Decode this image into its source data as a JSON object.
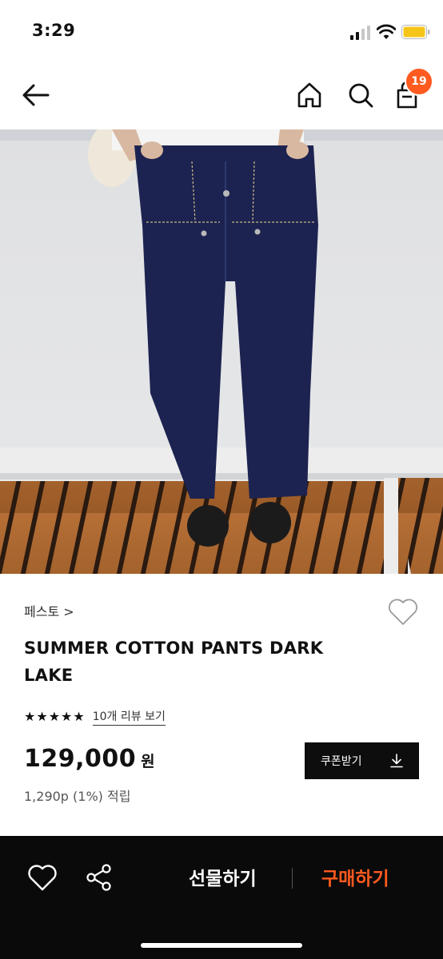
{
  "status_bar": {
    "time": "3:29"
  },
  "nav": {
    "cart_count": "19"
  },
  "product": {
    "brand": "페스토 >",
    "title": "SUMMER COTTON PANTS DARK LAKE",
    "stars": [
      "★",
      "★",
      "★",
      "★",
      "★"
    ],
    "review_link": "10개 리뷰 보기",
    "price": "129,000",
    "currency": "원",
    "points": "1,290p (1%) 적립",
    "coupon_label": "쿠폰받기"
  },
  "bottom_bar": {
    "gift_label": "선물하기",
    "buy_label": "구매하기"
  },
  "colors": {
    "accent": "#ff5a1f",
    "bar_background": "#0a0a0a",
    "pants": "#1c2350"
  }
}
